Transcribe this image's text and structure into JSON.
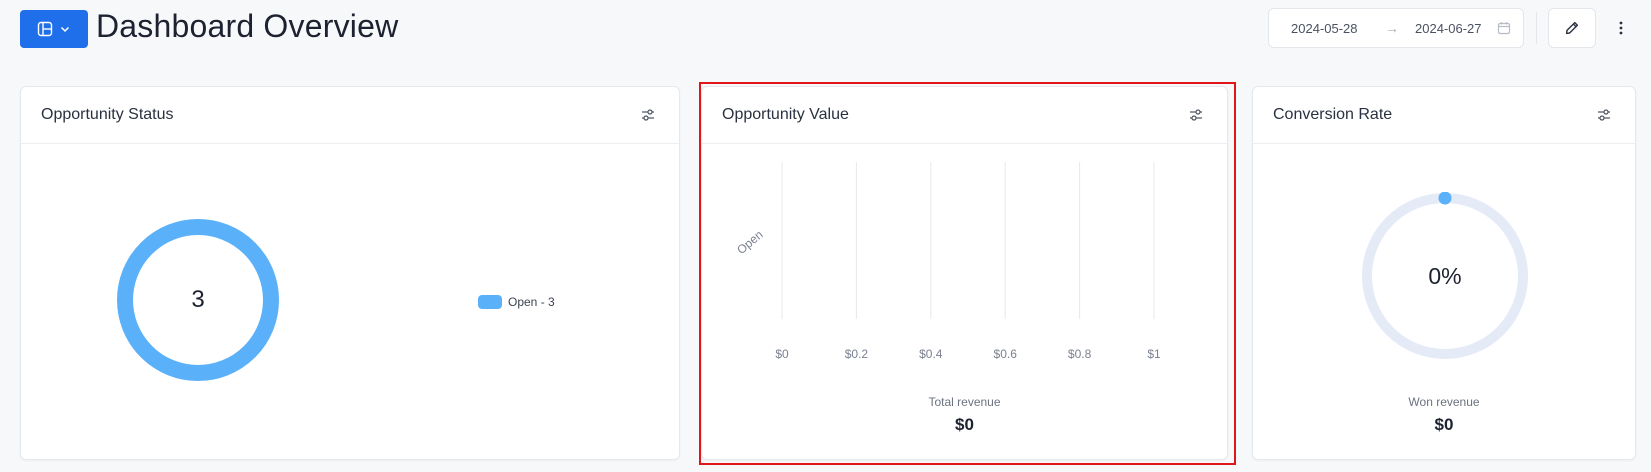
{
  "header": {
    "title": "Dashboard Overview",
    "view_switch_icon": "layout-icon",
    "date_from": "2024-05-28",
    "date_to": "2024-06-27",
    "arrow_glyph": "→"
  },
  "colors": {
    "accent": "#1f6feb",
    "series": "#5ab1f9",
    "gauge_track": "#e4ebf7"
  },
  "cards": {
    "status": {
      "title": "Opportunity Status",
      "center_value": "3",
      "legend": [
        {
          "label": "Open - 3",
          "value": 3
        }
      ]
    },
    "value": {
      "title": "Opportunity Value",
      "summary_label": "Total revenue",
      "summary_value": "$0"
    },
    "conversion": {
      "title": "Conversion Rate",
      "center_value": "0%",
      "rate_fraction": 0,
      "summary_label": "Won revenue",
      "summary_value": "$0"
    }
  },
  "chart_data": {
    "type": "bar",
    "orientation": "horizontal",
    "categories": [
      "Open"
    ],
    "series": [
      {
        "values": [
          0
        ]
      }
    ],
    "x_ticks": [
      "$0",
      "$0.2",
      "$0.4",
      "$0.6",
      "$0.8",
      "$1"
    ],
    "xlim": [
      0,
      1
    ],
    "grid": true
  }
}
